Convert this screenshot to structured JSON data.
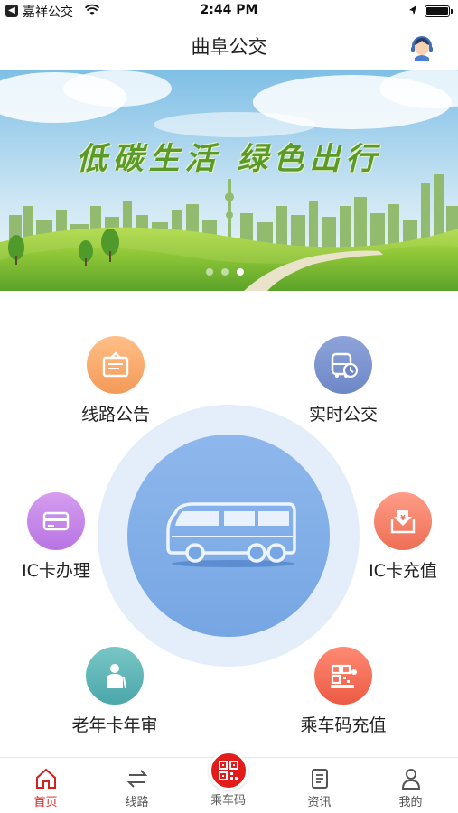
{
  "status_bar": {
    "carrier": "嘉祥公交",
    "time": "2:44 PM",
    "icons": [
      "back-app-icon",
      "wifi-icon",
      "location-arrow-icon",
      "battery-icon"
    ]
  },
  "nav": {
    "title": "曲阜公交",
    "avatar_icon": "customer-service-avatar-icon"
  },
  "banner": {
    "slogan": "低碳生活 绿色出行",
    "page_count": 3,
    "active_page": 3
  },
  "features": {
    "route_notice": {
      "label": "线路公告",
      "icon": "notice-board-icon",
      "color": "#f49a58"
    },
    "realtime_bus": {
      "label": "实时公交",
      "icon": "bus-clock-icon",
      "color": "#6e87c7"
    },
    "ic_card": {
      "label": "IC卡办理",
      "icon": "card-icon",
      "color": "#b874e2"
    },
    "ic_recharge": {
      "label": "IC卡充值",
      "icon": "yuan-download-icon",
      "color": "#ee6e55"
    },
    "elder_card": {
      "label": "老年卡年审",
      "icon": "elder-person-icon",
      "color": "#4ba7aa"
    },
    "qr_recharge": {
      "label": "乘车码充值",
      "icon": "qr-bus-icon",
      "color": "#ec5a44"
    }
  },
  "center": {
    "icon": "bus-icon",
    "color": "#76a6e3"
  },
  "tab_bar": {
    "accent": "#d61f1f",
    "tabs": [
      {
        "label": "首页",
        "icon": "home-icon",
        "active": true
      },
      {
        "label": "线路",
        "icon": "swap-arrows-icon",
        "active": false
      },
      {
        "label": "乘车码",
        "icon": "qr-code-icon",
        "active": false
      },
      {
        "label": "资讯",
        "icon": "news-icon",
        "active": false
      },
      {
        "label": "我的",
        "icon": "user-icon",
        "active": false
      }
    ]
  }
}
